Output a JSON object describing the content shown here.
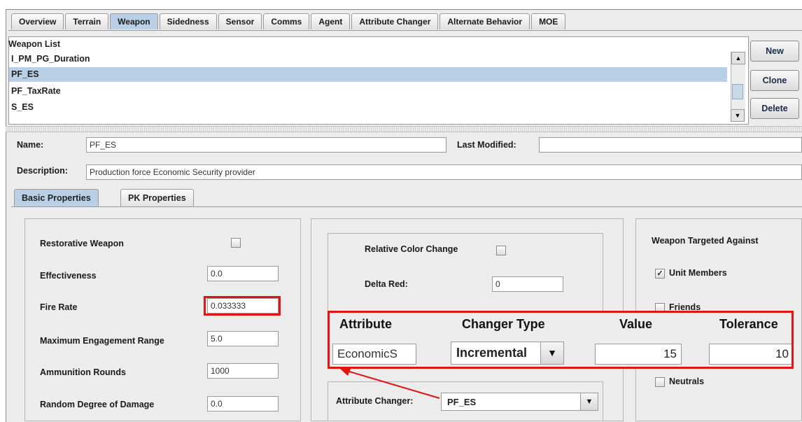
{
  "tabs": [
    {
      "label": "Overview",
      "active": false
    },
    {
      "label": "Terrain",
      "active": false
    },
    {
      "label": "Weapon",
      "active": true
    },
    {
      "label": "Sidedness",
      "active": false
    },
    {
      "label": "Sensor",
      "active": false
    },
    {
      "label": "Comms",
      "active": false
    },
    {
      "label": "Agent",
      "active": false
    },
    {
      "label": "Attribute Changer",
      "active": false
    },
    {
      "label": "Alternate Behavior",
      "active": false
    },
    {
      "label": "MOE",
      "active": false
    }
  ],
  "weapon_list": {
    "title": "Weapon List",
    "items": [
      "I_PM_PG_Duration",
      "PF_ES",
      "PF_TaxRate",
      "S_ES"
    ],
    "selected": "PF_ES"
  },
  "buttons": {
    "new": "New",
    "clone": "Clone",
    "delete": "Delete"
  },
  "form": {
    "name_label": "Name:",
    "name_value": "PF_ES",
    "last_modified_label": "Last Modified:",
    "last_modified_value": "",
    "description_label": "Description:",
    "description_value": "Production force Economic Security provider"
  },
  "subtabs": [
    {
      "label": "Basic Properties",
      "active": true
    },
    {
      "label": "PK Properties",
      "active": false
    }
  ],
  "basic": {
    "restorative_label": "Restorative Weapon",
    "restorative_checked": false,
    "effectiveness_label": "Effectiveness",
    "effectiveness_value": "0.0",
    "fire_rate_label": "Fire Rate",
    "fire_rate_value": "0.033333",
    "max_range_label": "Maximum Engagement Range",
    "max_range_value": "5.0",
    "ammo_label": "Ammunition Rounds",
    "ammo_value": "1000",
    "random_damage_label": "Random Degree of Damage",
    "random_damage_value": "0.0"
  },
  "color": {
    "relative_label": "Relative Color Change",
    "relative_checked": false,
    "delta_red_label": "Delta Red:",
    "delta_red_value": "0",
    "attribute_changer_label": "Attribute Changer:",
    "attribute_changer_value": "PF_ES"
  },
  "targeted": {
    "title": "Weapon Targeted Against",
    "unit_members": "Unit Members",
    "unit_members_checked": true,
    "friends": "Friends",
    "friends_checked": false,
    "neutrals": "Neutrals",
    "neutrals_checked": false
  },
  "overlay": {
    "headers": {
      "attribute": "Attribute",
      "changer_type": "Changer Type",
      "value": "Value",
      "tolerance": "Tolerance"
    },
    "attribute_value": "EconomicS",
    "changer_type_value": "Incremental",
    "value_value": "15",
    "tolerance_value": "10"
  },
  "colors": {
    "highlight": "#e01515",
    "selection": "#b8cfe5",
    "background": "#ececec"
  }
}
